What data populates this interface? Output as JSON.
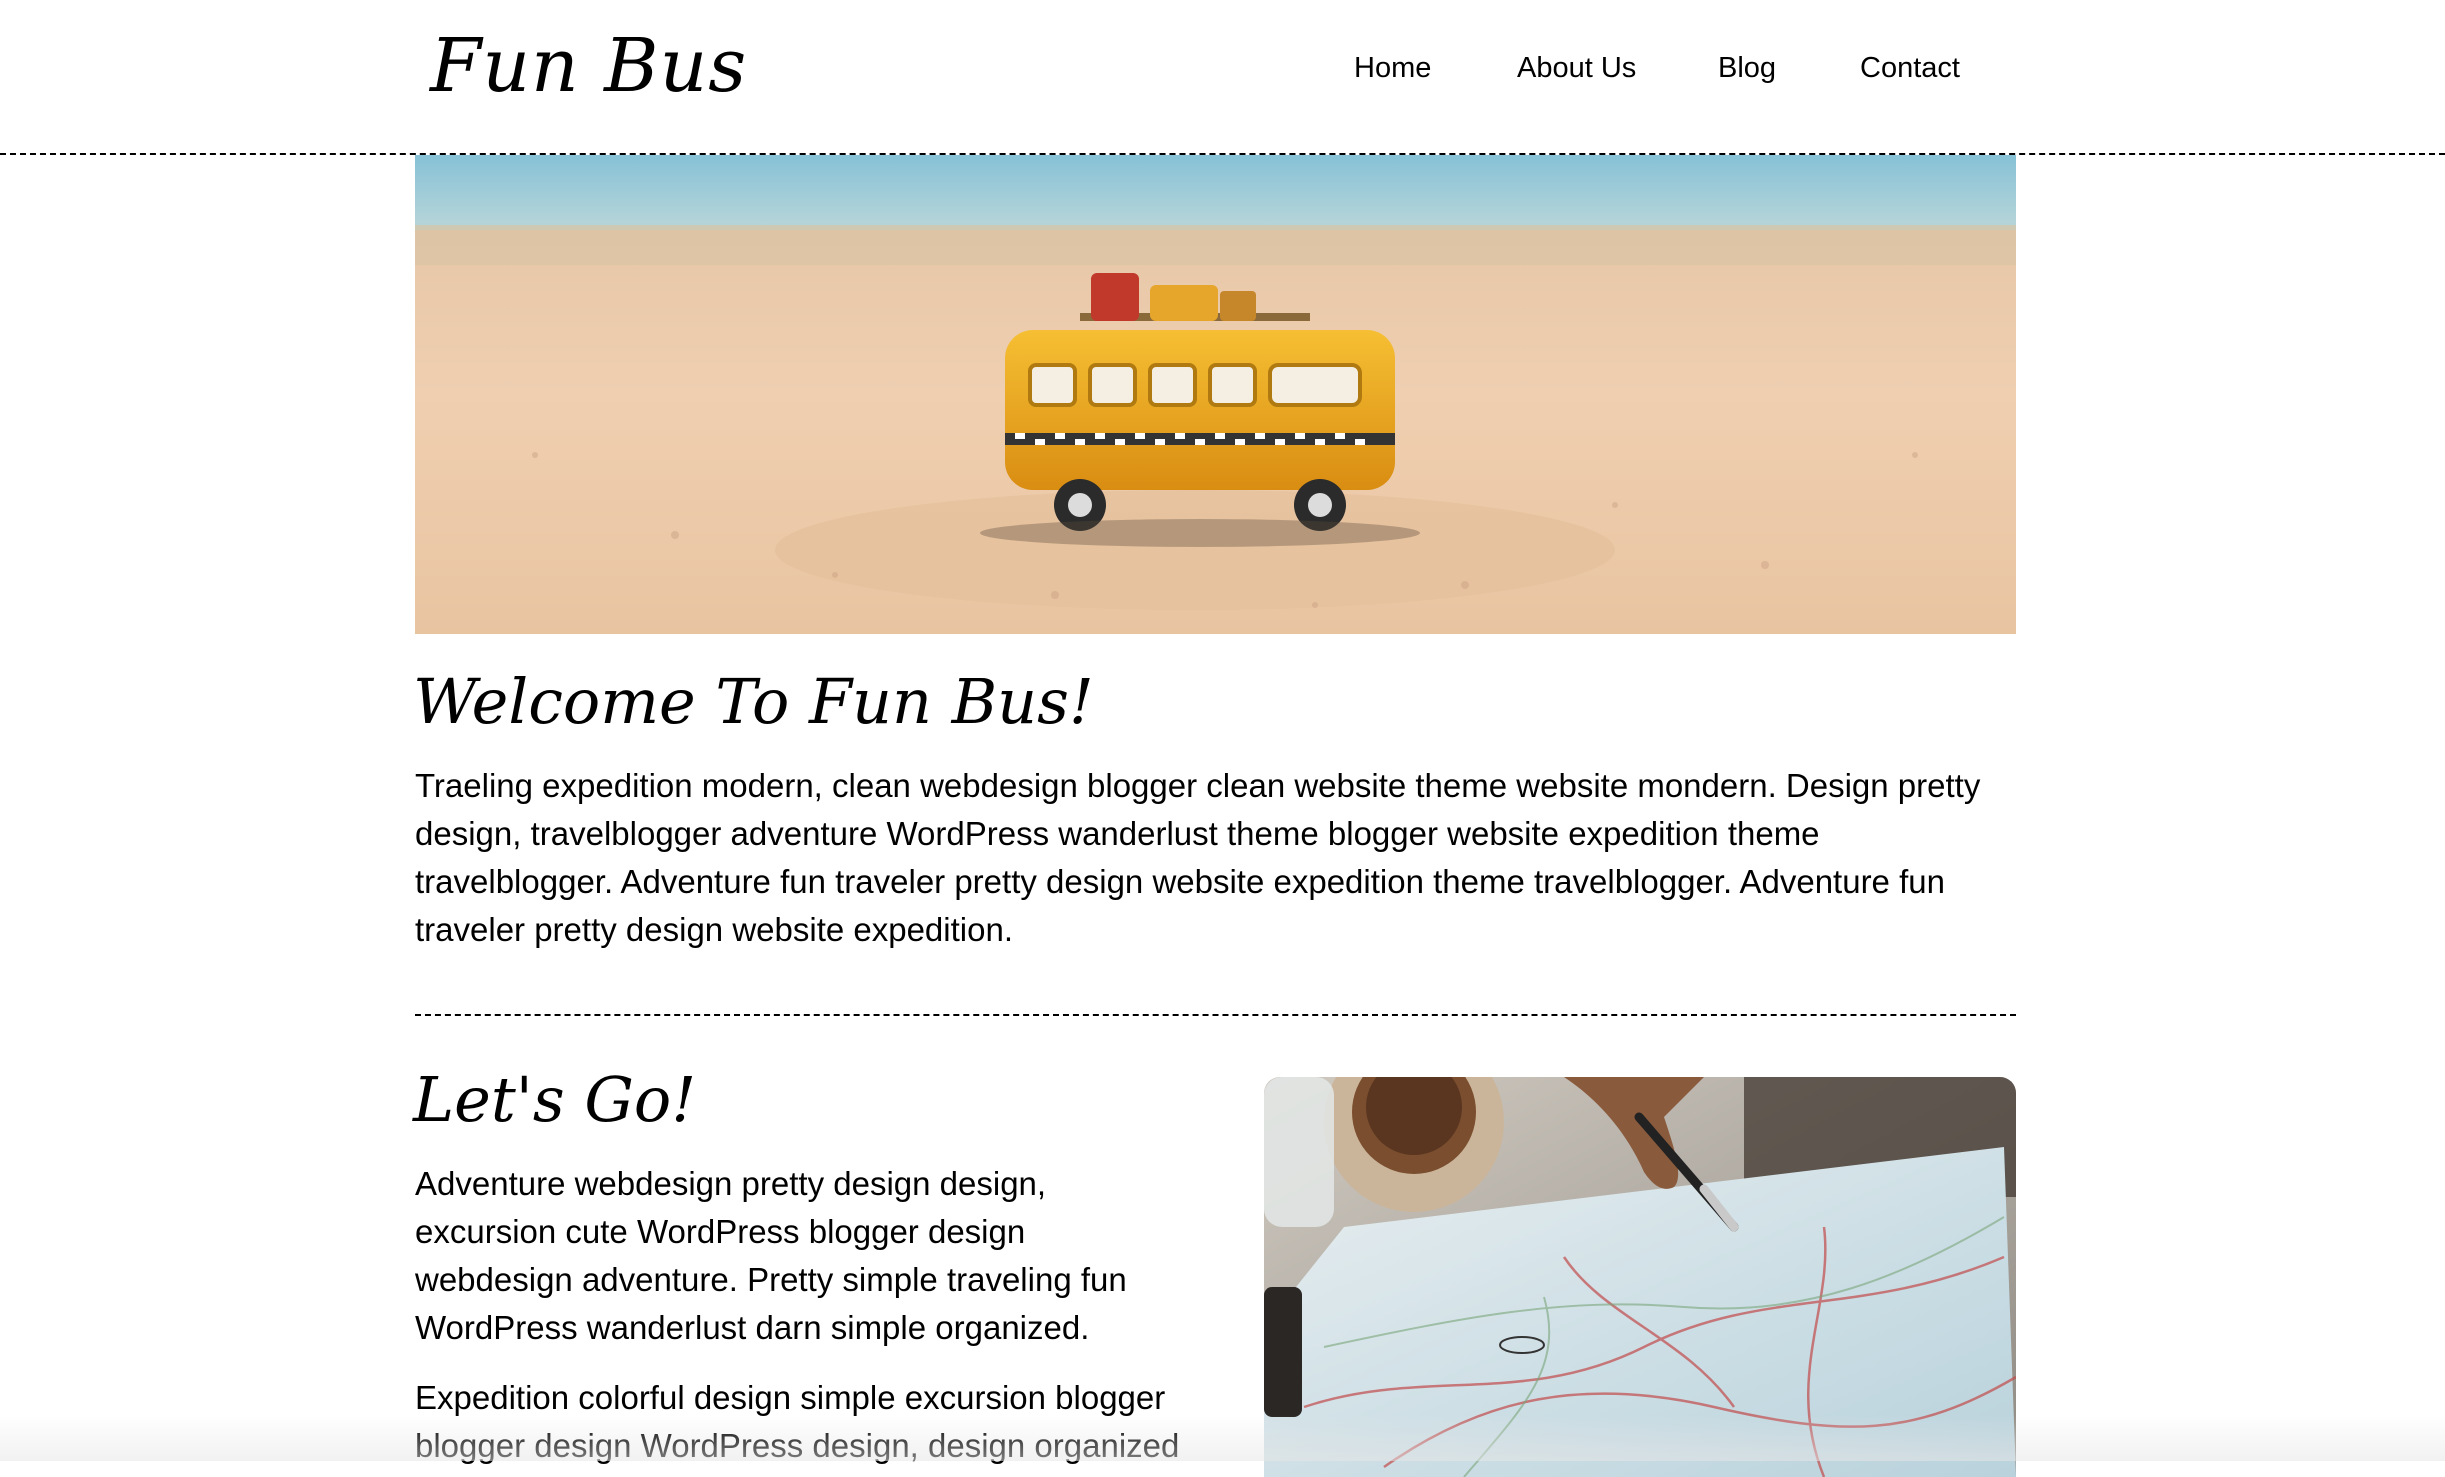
{
  "header": {
    "brand": "Fun Bus",
    "nav": [
      {
        "label": "Home"
      },
      {
        "label": "About Us"
      },
      {
        "label": "Blog"
      },
      {
        "label": "Contact"
      }
    ]
  },
  "welcome": {
    "title": "Welcome To Fun Bus!",
    "body": "Traeling expedition modern, clean webdesign blogger clean website theme website mondern. Design pretty design, travelblogger adventure WordPress wanderlust theme blogger website expedition theme travelblogger. Adventure fun traveler pretty design website expedition theme travelblogger. Adventure fun traveler pretty design website expedition."
  },
  "lets_go": {
    "title": "Let's Go!",
    "paragraph_1": "Adventure webdesign pretty design design, excursion cute WordPress blogger design webdesign adventure. Pretty simple traveling fun WordPress wanderlust darn simple organized.",
    "paragraph_2": "Expedition colorful design simple excursion blogger blogger design WordPress design, design organized"
  },
  "colors": {
    "text": "#000000",
    "background": "#ffffff",
    "bus_yellow": "#f2b322",
    "sand": "#e8c6a4",
    "sea": "#8fc3d6"
  }
}
